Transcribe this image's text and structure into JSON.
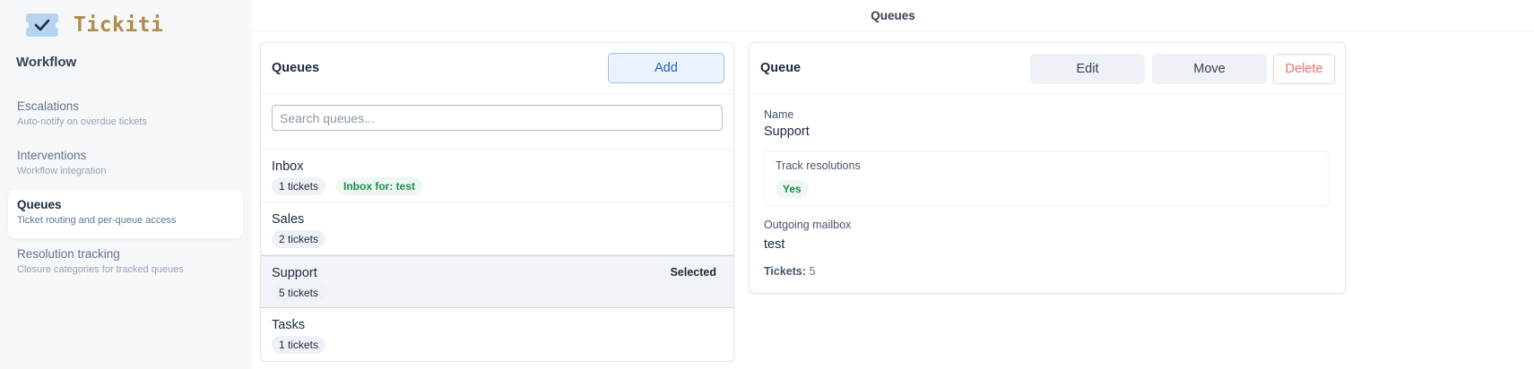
{
  "app": {
    "name": "Tickiti"
  },
  "topbar": {
    "title": "Queues"
  },
  "sidebar": {
    "heading": "Workflow",
    "items": [
      {
        "title": "Escalations",
        "subtitle": "Auto-notify on overdue tickets"
      },
      {
        "title": "Interventions",
        "subtitle": "Workflow integration"
      },
      {
        "title": "Queues",
        "subtitle": "Ticket routing and per-queue access"
      },
      {
        "title": "Resolution tracking",
        "subtitle": "Closure categories for tracked queues"
      }
    ]
  },
  "queues_panel": {
    "title": "Queues",
    "add_label": "Add",
    "search_placeholder": "Search queues...",
    "selected_label": "Selected",
    "rows": [
      {
        "name": "Inbox",
        "tickets": "1 tickets",
        "extra_tag": "Inbox for: test"
      },
      {
        "name": "Sales",
        "tickets": "2 tickets"
      },
      {
        "name": "Support",
        "tickets": "5 tickets",
        "selected": true
      },
      {
        "name": "Tasks",
        "tickets": "1 tickets"
      }
    ]
  },
  "detail_panel": {
    "title": "Queue",
    "edit_label": "Edit",
    "move_label": "Move",
    "delete_label": "Delete",
    "name_label": "Name",
    "name_value": "Support",
    "track_label": "Track resolutions",
    "track_value": "Yes",
    "mailbox_label": "Outgoing mailbox",
    "mailbox_value": "test",
    "tickets_label": "Tickets:",
    "tickets_value": "5"
  },
  "colors": {
    "brand": "#b08a4a",
    "accent": "#2563b8",
    "success": "#1f8a4c",
    "danger": "#e57373"
  }
}
